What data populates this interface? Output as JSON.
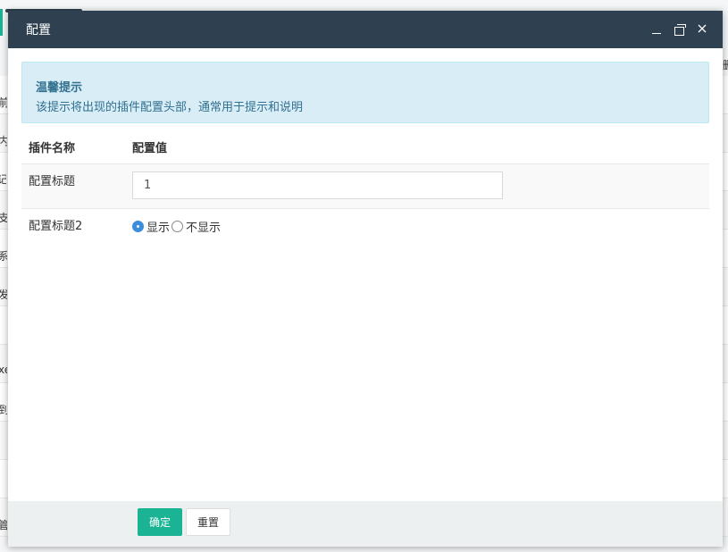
{
  "background": {
    "left_fragments": [
      "前",
      "内",
      "记",
      "支",
      "系",
      "发",
      "",
      "xe",
      "到",
      "",
      "管"
    ],
    "right_fragments": [
      "删"
    ]
  },
  "dialog": {
    "title": "配置",
    "controls": {
      "minimize_icon": "minimize-icon",
      "maximize_icon": "restore-icon",
      "close_icon": "close-icon"
    },
    "alert": {
      "title": "温馨提示",
      "text": "该提示将出现的插件配置头部，通常用于提示和说明"
    },
    "table": {
      "headers": [
        "插件名称",
        "配置值"
      ],
      "rows": [
        {
          "name": "配置标题",
          "type": "text",
          "value": "1"
        },
        {
          "name": "配置标题2",
          "type": "radio",
          "options": [
            "显示",
            "不显示"
          ],
          "selected": "显示"
        }
      ]
    },
    "footer": {
      "confirm_label": "确定",
      "reset_label": "重置"
    }
  },
  "colors": {
    "header_bg": "#2f4050",
    "primary": "#1ab394",
    "alert_bg": "#d9edf7",
    "alert_text": "#31708f",
    "radio_checked": "#3c8ddc"
  }
}
